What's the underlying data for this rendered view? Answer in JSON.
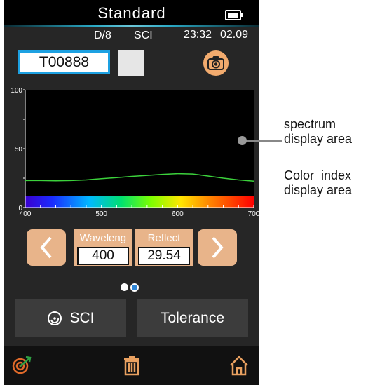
{
  "header": {
    "title": "Standard",
    "battery": "battery-full-icon"
  },
  "status": {
    "geometry": "D/8",
    "mode": "SCI",
    "time": "23:32",
    "date": "02.09"
  },
  "sample": {
    "id": "T00888",
    "swatch_color": "#e6e6e6"
  },
  "chart_data": {
    "type": "line",
    "x_ticks": [
      "400",
      "500",
      "600",
      "700"
    ],
    "y_ticks": [
      "0",
      "50",
      "100"
    ],
    "xlim": [
      400,
      700
    ],
    "ylim": [
      0,
      100
    ],
    "series": [
      {
        "color": "#3cd23c",
        "x": [
          400,
          420,
          440,
          460,
          480,
          500,
          520,
          540,
          560,
          580,
          600,
          620,
          640,
          660,
          680,
          700
        ],
        "y": [
          23,
          23,
          22.8,
          23,
          23.5,
          24.5,
          25.5,
          26.5,
          27.3,
          28.2,
          28.8,
          28.5,
          26.8,
          25,
          23.5,
          22.5
        ]
      }
    ]
  },
  "controls": {
    "wavelength_label": "Waveleng",
    "wavelength_value": "400",
    "reflect_label": "Reflect",
    "reflect_value": "29.54"
  },
  "buttons": {
    "sci_label": "SCI",
    "tolerance_label": "Tolerance"
  },
  "annotations": {
    "spectrum_line1": "spectrum",
    "spectrum_line2": "display area",
    "color_line1": "Color  index",
    "color_line2": "display area"
  },
  "colors": {
    "accent_orange": "#e8b48a",
    "highlight_blue": "#1da1e2",
    "spectrum_line": "#3cd23c"
  }
}
